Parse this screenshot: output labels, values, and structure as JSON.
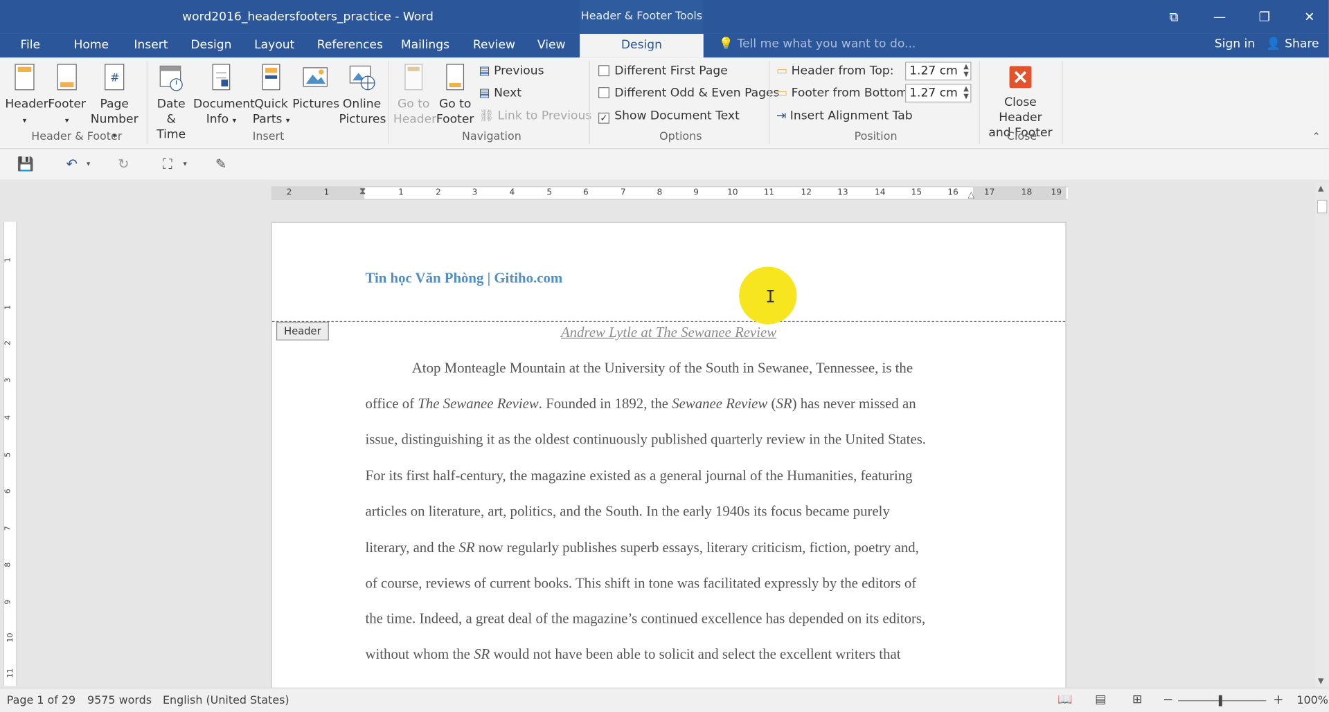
{
  "window": {
    "title": "word2016_headersfooters_practice - Word",
    "contextual_tab_group": "Header & Footer Tools",
    "controls": [
      "⧉",
      "—",
      "❐",
      "✕"
    ]
  },
  "tabs": [
    {
      "label": "File"
    },
    {
      "label": "Home"
    },
    {
      "label": "Insert"
    },
    {
      "label": "Design"
    },
    {
      "label": "Layout"
    },
    {
      "label": "References"
    },
    {
      "label": "Mailings"
    },
    {
      "label": "Review"
    },
    {
      "label": "View"
    }
  ],
  "active_tab": "Design",
  "tell_me_placeholder": "Tell me what you want to do...",
  "sign_in": "Sign in",
  "share": "Share",
  "ribbon": {
    "header_footer": {
      "header": "Header",
      "footer": "Footer",
      "page_number_1": "Page",
      "page_number_2": "Number",
      "label": "Header & Footer"
    },
    "insert": {
      "date_time_1": "Date &",
      "date_time_2": "Time",
      "doc_info_1": "Document",
      "doc_info_2": "Info",
      "quick_parts_1": "Quick",
      "quick_parts_2": "Parts",
      "pictures": "Pictures",
      "online_pictures_1": "Online",
      "online_pictures_2": "Pictures",
      "label": "Insert"
    },
    "navigation": {
      "goto_header_1": "Go to",
      "goto_header_2": "Header",
      "goto_footer_1": "Go to",
      "goto_footer_2": "Footer",
      "previous": "Previous",
      "next": "Next",
      "link_previous": "Link to Previous",
      "label": "Navigation"
    },
    "options": {
      "different_first_page": "Different First Page",
      "different_odd_even": "Different Odd & Even Pages",
      "show_document_text": "Show Document Text",
      "label": "Options"
    },
    "position": {
      "header_from_top": "Header from Top:",
      "header_from_top_value": "1.27 cm",
      "footer_from_bottom": "Footer from Bottom:",
      "footer_from_bottom_value": "1.27 cm",
      "insert_alignment_tab": "Insert Alignment Tab",
      "label": "Position"
    },
    "close": {
      "close_1": "Close Header",
      "close_2": "and Footer",
      "label": "Close"
    }
  },
  "ruler_numbers": [
    "2",
    "1",
    "1",
    "2",
    "3",
    "4",
    "5",
    "6",
    "7",
    "8",
    "9",
    "10",
    "11",
    "12",
    "13",
    "14",
    "15",
    "16",
    "17",
    "18",
    "19"
  ],
  "vruler_numbers": [
    "1",
    "1",
    "2",
    "3",
    "4",
    "5",
    "6",
    "7",
    "8",
    "9",
    "10",
    "11"
  ],
  "document": {
    "header_text": "Tin học Văn Phòng | Gitiho.com",
    "header_tag": "Header",
    "title": "Andrew Lytle at The Sewanee Review",
    "lines": [
      [
        "Atop Monteagle Mountain at the University of the South in Sewanee, Tennessee, is the"
      ],
      [
        "office of ",
        "The Sewanee Review",
        ". Founded in 1892, the ",
        "Sewanee Review",
        " (",
        "SR",
        ") has never missed an"
      ],
      [
        "issue, distinguishing it as the oldest continuously published quarterly review in the United States."
      ],
      [
        "For its first half-century, the magazine existed as a general journal of the Humanities, featuring"
      ],
      [
        "articles on literature, art, politics, and the South. In the early 1940s its focus became purely"
      ],
      [
        "literary, and the ",
        "SR",
        " now regularly publishes superb essays, literary criticism, fiction, poetry and,"
      ],
      [
        "of course, reviews of current books. This shift in tone was facilitated expressly by the editors of"
      ],
      [
        "the time. Indeed, a great deal of the magazine’s continued excellence has depended on its editors,"
      ],
      [
        "without whom the ",
        "SR",
        " would not have been able to solicit and select the excellent writers that"
      ]
    ]
  },
  "status": {
    "page": "Page 1 of 29",
    "words": "9575 words",
    "language": "English (United States)",
    "zoom": "100%"
  }
}
